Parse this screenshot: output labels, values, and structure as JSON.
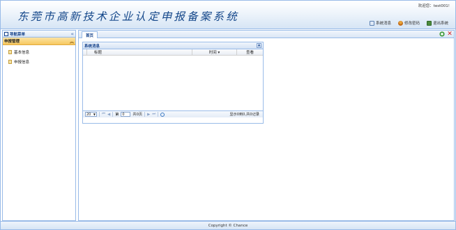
{
  "header": {
    "title": "东莞市高新技术企业认定申报备案系统",
    "welcome": "欢迎您：test001!",
    "links": [
      {
        "label": "系统消息",
        "icon": "message-icon"
      },
      {
        "label": "修改密码",
        "icon": "user-key-icon"
      },
      {
        "label": "退出系统",
        "icon": "exit-icon"
      }
    ]
  },
  "sidebar": {
    "title": "导航菜单",
    "section": "申报管理",
    "items": [
      {
        "label": "基本信息",
        "icon": "document-icon"
      },
      {
        "label": "申报信息",
        "icon": "document-icon"
      }
    ]
  },
  "main": {
    "tabs": [
      {
        "label": "首页"
      }
    ],
    "panel": {
      "title": "系统消息",
      "columns": [
        "标题",
        "时间 ▾",
        "查看"
      ],
      "rows": []
    },
    "pager": {
      "page_size": "20",
      "page_prefix": "第",
      "page_value": "0",
      "page_suffix": "共0页",
      "info": "显示0到0,共0记录"
    }
  },
  "footer": {
    "copyright": "Copyright © Chance"
  },
  "colors": {
    "title": "#14478a",
    "border": "#99bbe8",
    "accordion_active": "#f7c85e",
    "close_red": "#d42020"
  }
}
